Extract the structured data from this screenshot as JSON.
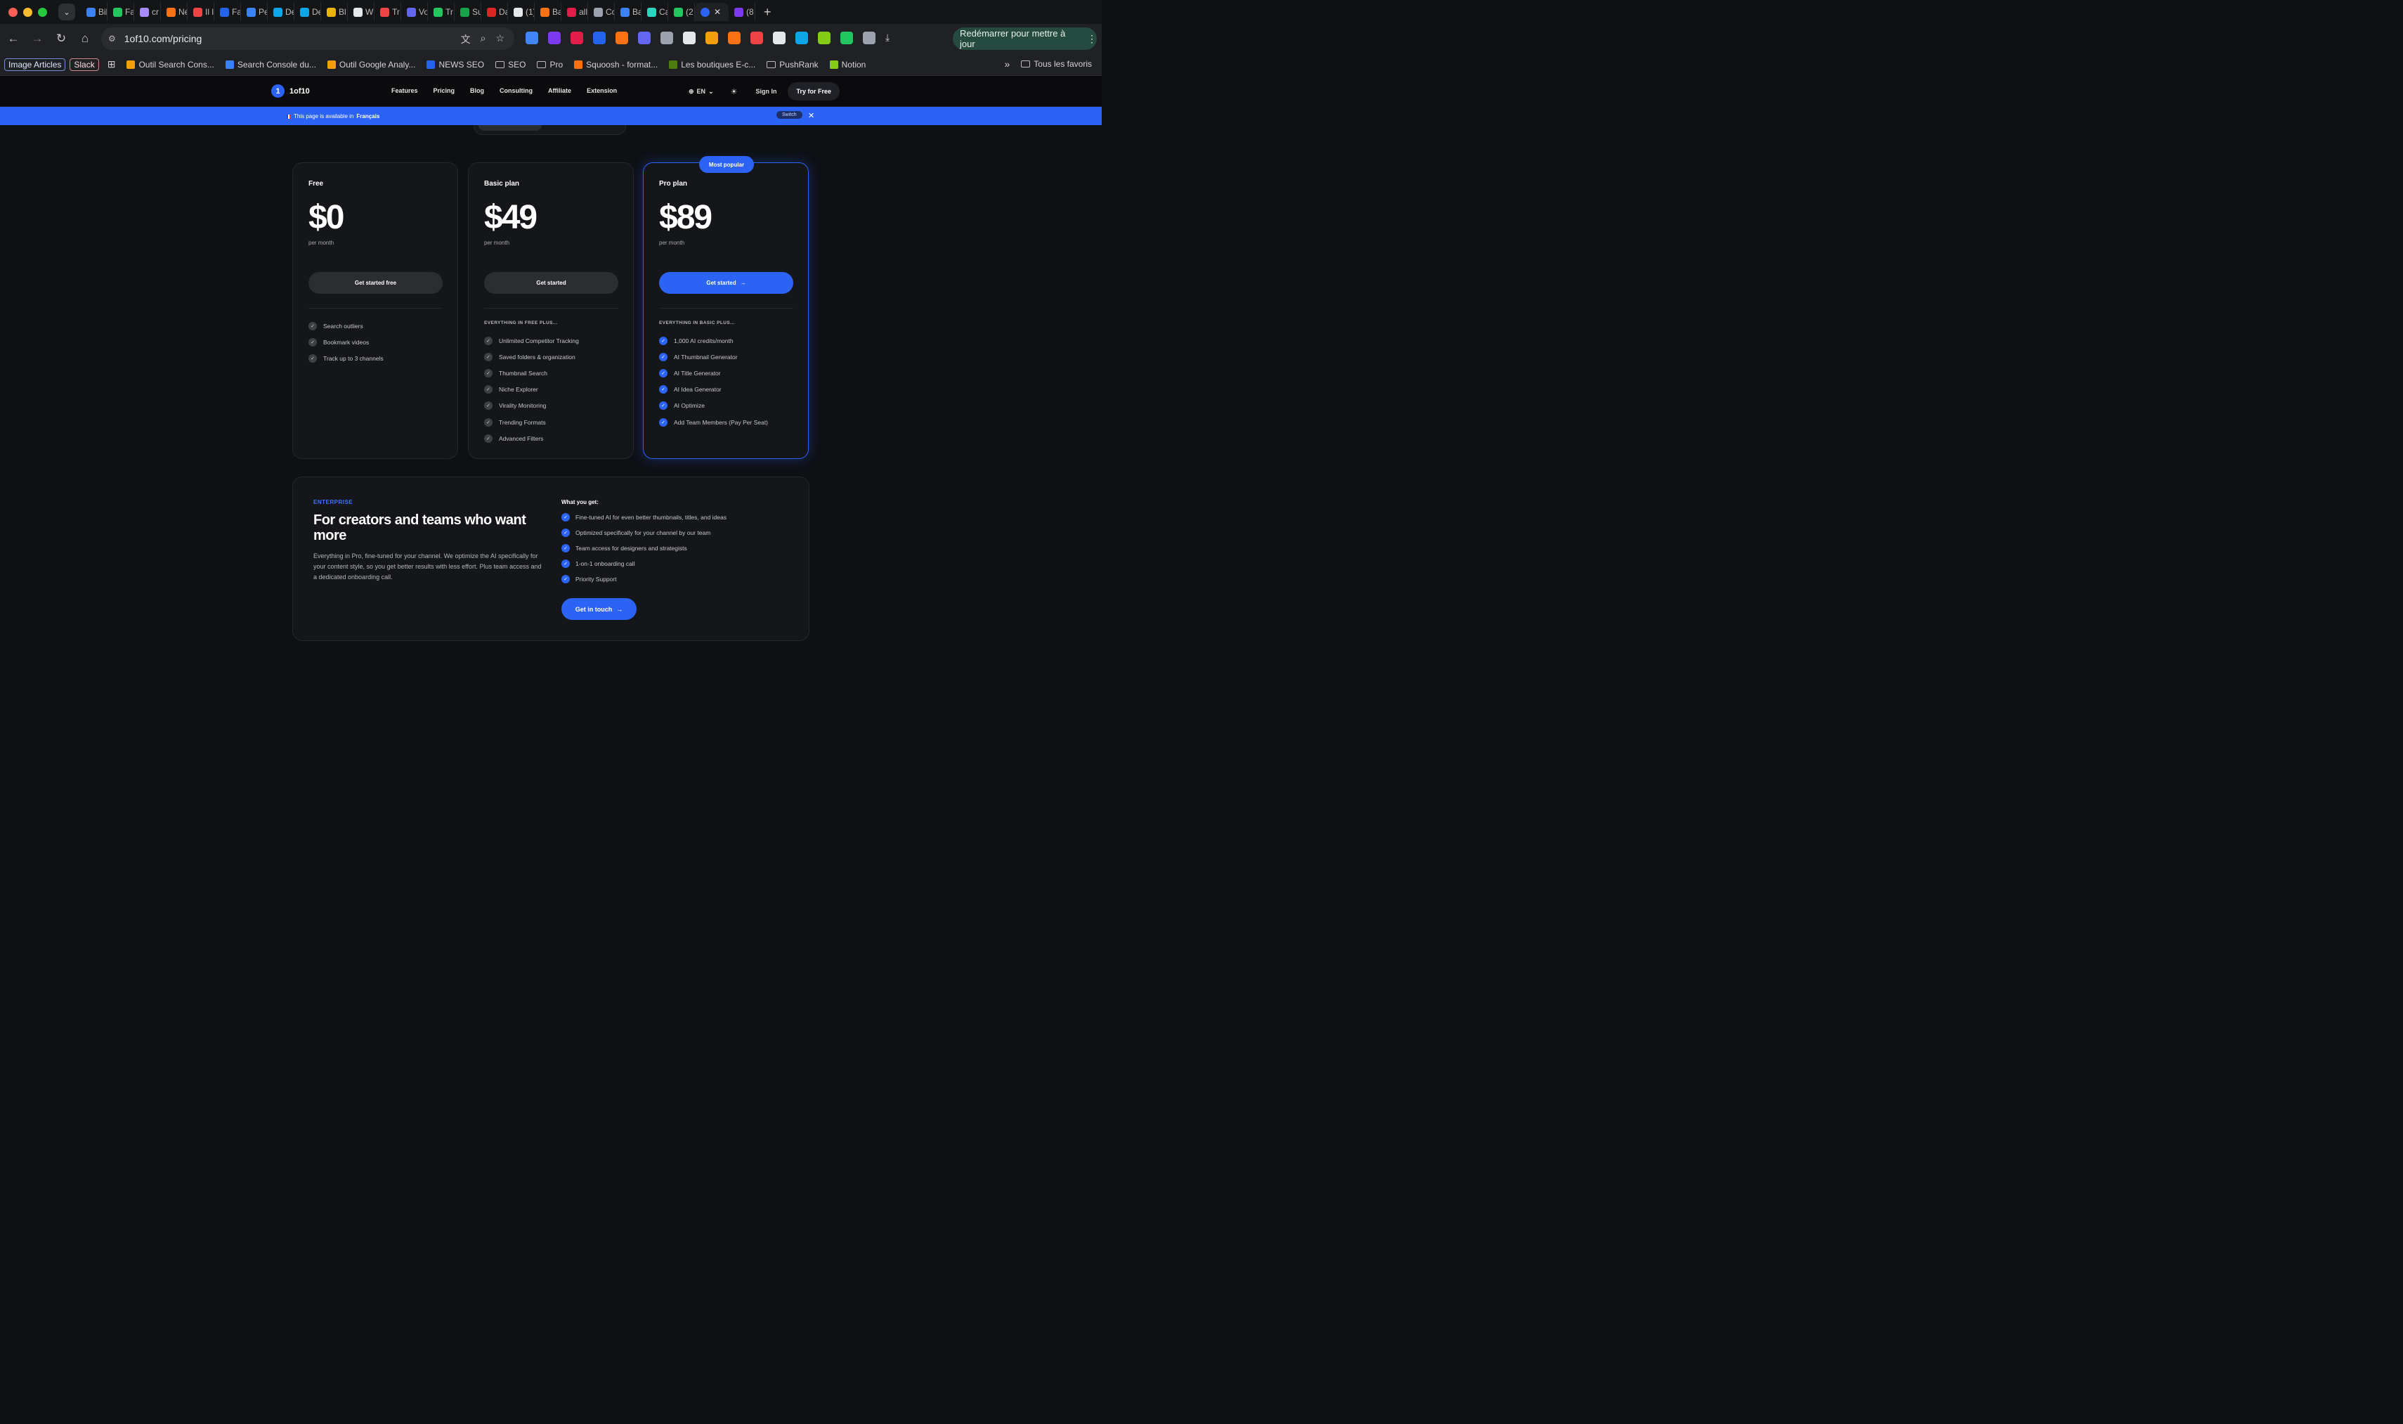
{
  "browser": {
    "tabs": [
      {
        "label": "Bil",
        "color": "#3b82f6"
      },
      {
        "label": "Fa",
        "color": "#22c55e"
      },
      {
        "label": "cr",
        "color": "#a78bfa"
      },
      {
        "label": "Né",
        "color": "#f97316"
      },
      {
        "label": "Il l",
        "color": "#ef4444"
      },
      {
        "label": "Fa",
        "color": "#2563eb"
      },
      {
        "label": "Pe",
        "color": "#3b82f6"
      },
      {
        "label": "De",
        "color": "#0ea5e9"
      },
      {
        "label": "De",
        "color": "#0ea5e9"
      },
      {
        "label": "Bl",
        "color": "#eab308"
      },
      {
        "label": "Wi",
        "color": "#e5e7eb"
      },
      {
        "label": "Tr",
        "color": "#ef4444"
      },
      {
        "label": "Vo",
        "color": "#6366f1"
      },
      {
        "label": "Tr",
        "color": "#22c55e"
      },
      {
        "label": "Su",
        "color": "#16a34a"
      },
      {
        "label": "Da",
        "color": "#dc2626"
      },
      {
        "label": "(1)",
        "color": "#e5e7eb"
      },
      {
        "label": "Ba",
        "color": "#f97316"
      },
      {
        "label": "all",
        "color": "#e11d48"
      },
      {
        "label": "Cc",
        "color": "#9ca3af"
      },
      {
        "label": "Ba",
        "color": "#3b82f6"
      },
      {
        "label": "Ca",
        "color": "#2dd4bf"
      },
      {
        "label": "(2",
        "color": "#22c55e"
      }
    ],
    "active_tab": {
      "label": "1",
      "close": "✕"
    },
    "last_tab": {
      "label": "(8",
      "color": "#7c3aed"
    },
    "new_tab": "+",
    "url": "1of10.com/pricing",
    "relaunch": "Redémarrer pour mettre à jour",
    "bookmarks_pills": [
      "Image Articles",
      "Slack"
    ],
    "bookmarks": [
      {
        "label": "Outil Search Cons...",
        "color": "#f59e0b"
      },
      {
        "label": "Search Console du...",
        "color": "#3b82f6"
      },
      {
        "label": "Outil Google Analy...",
        "color": "#f59e0b"
      },
      {
        "label": "NEWS SEO",
        "color": "#2563eb"
      },
      {
        "label": "SEO",
        "folder": true
      },
      {
        "label": "Pro",
        "folder": true
      },
      {
        "label": "Squoosh - format...",
        "color": "#f97316"
      },
      {
        "label": "Les boutiques E-c...",
        "color": "#4d7c0f"
      },
      {
        "label": "PushRank",
        "folder": true
      },
      {
        "label": "Notion",
        "color": "#84cc16"
      }
    ],
    "bookmarks_more": "»",
    "all_bookmarks": "Tous les favoris",
    "extension_colors": [
      "#4285f4",
      "#7c3aed",
      "#e11d48",
      "#2563eb",
      "#f97316",
      "#6366f1",
      "#9ca3af",
      "#e5e7eb",
      "#f59e0b",
      "#f97316",
      "#ef4444",
      "#e5e7eb",
      "#0ea5e9",
      "#84cc16",
      "#22c55e",
      "#9ca3af"
    ]
  },
  "nav": {
    "logo_mark": "1",
    "logo_text": "1of10",
    "items": [
      "Features",
      "Pricing",
      "Blog",
      "Consulting",
      "Affiliate",
      "Extension"
    ],
    "lang": "EN",
    "sign_in": "Sign In",
    "try_free": "Try for Free"
  },
  "banner": {
    "prefix": "This page is available in",
    "language": "Français",
    "switch": "Switch",
    "close": "✕"
  },
  "plans": [
    {
      "name": "Free",
      "price": "$0",
      "period": "per month",
      "cta": "Get started free",
      "includes": "",
      "features": [
        "Search outliers",
        "Bookmark videos",
        "Track up to 3 channels"
      ]
    },
    {
      "name": "Basic plan",
      "price": "$49",
      "period": "per month",
      "cta": "Get started",
      "includes": "EVERYTHING IN FREE PLUS...",
      "features": [
        "Unlimited Competitor Tracking",
        "Saved folders & organization",
        "Thumbnail Search",
        "Niche Explorer",
        "Virality Monitoring",
        "Trending Formats",
        "Advanced Filters"
      ]
    },
    {
      "name": "Pro plan",
      "price": "$89",
      "period": "per month",
      "cta": "Get started",
      "includes": "EVERYTHING IN BASIC PLUS...",
      "badge": "Most popular",
      "features": [
        "1,000 AI credits/month",
        "AI Thumbnail Generator",
        "AI Title Generator",
        "AI Idea Generator",
        "AI Optimize",
        "Add Team Members (Pay Per Seat)"
      ]
    }
  ],
  "enterprise": {
    "eyebrow": "ENTERPRISE",
    "title": "For creators and teams who want more",
    "description": "Everything in Pro, fine-tuned for your channel. We optimize the AI specifically for your content style, so you get better results with less effort. Plus team access and a dedicated onboarding call.",
    "what_you_get": "What you get:",
    "features": [
      "Fine-tuned AI for even better thumbnails, titles, and ideas",
      "Optimized specifically for your channel by our team",
      "Team access for designers and strategists",
      "1-on-1 onboarding call",
      "Priority Support"
    ],
    "cta": "Get in touch"
  },
  "colors": {
    "accent": "#2b63f5",
    "card_bg": "#151619",
    "page_bg": "#0e1014"
  }
}
